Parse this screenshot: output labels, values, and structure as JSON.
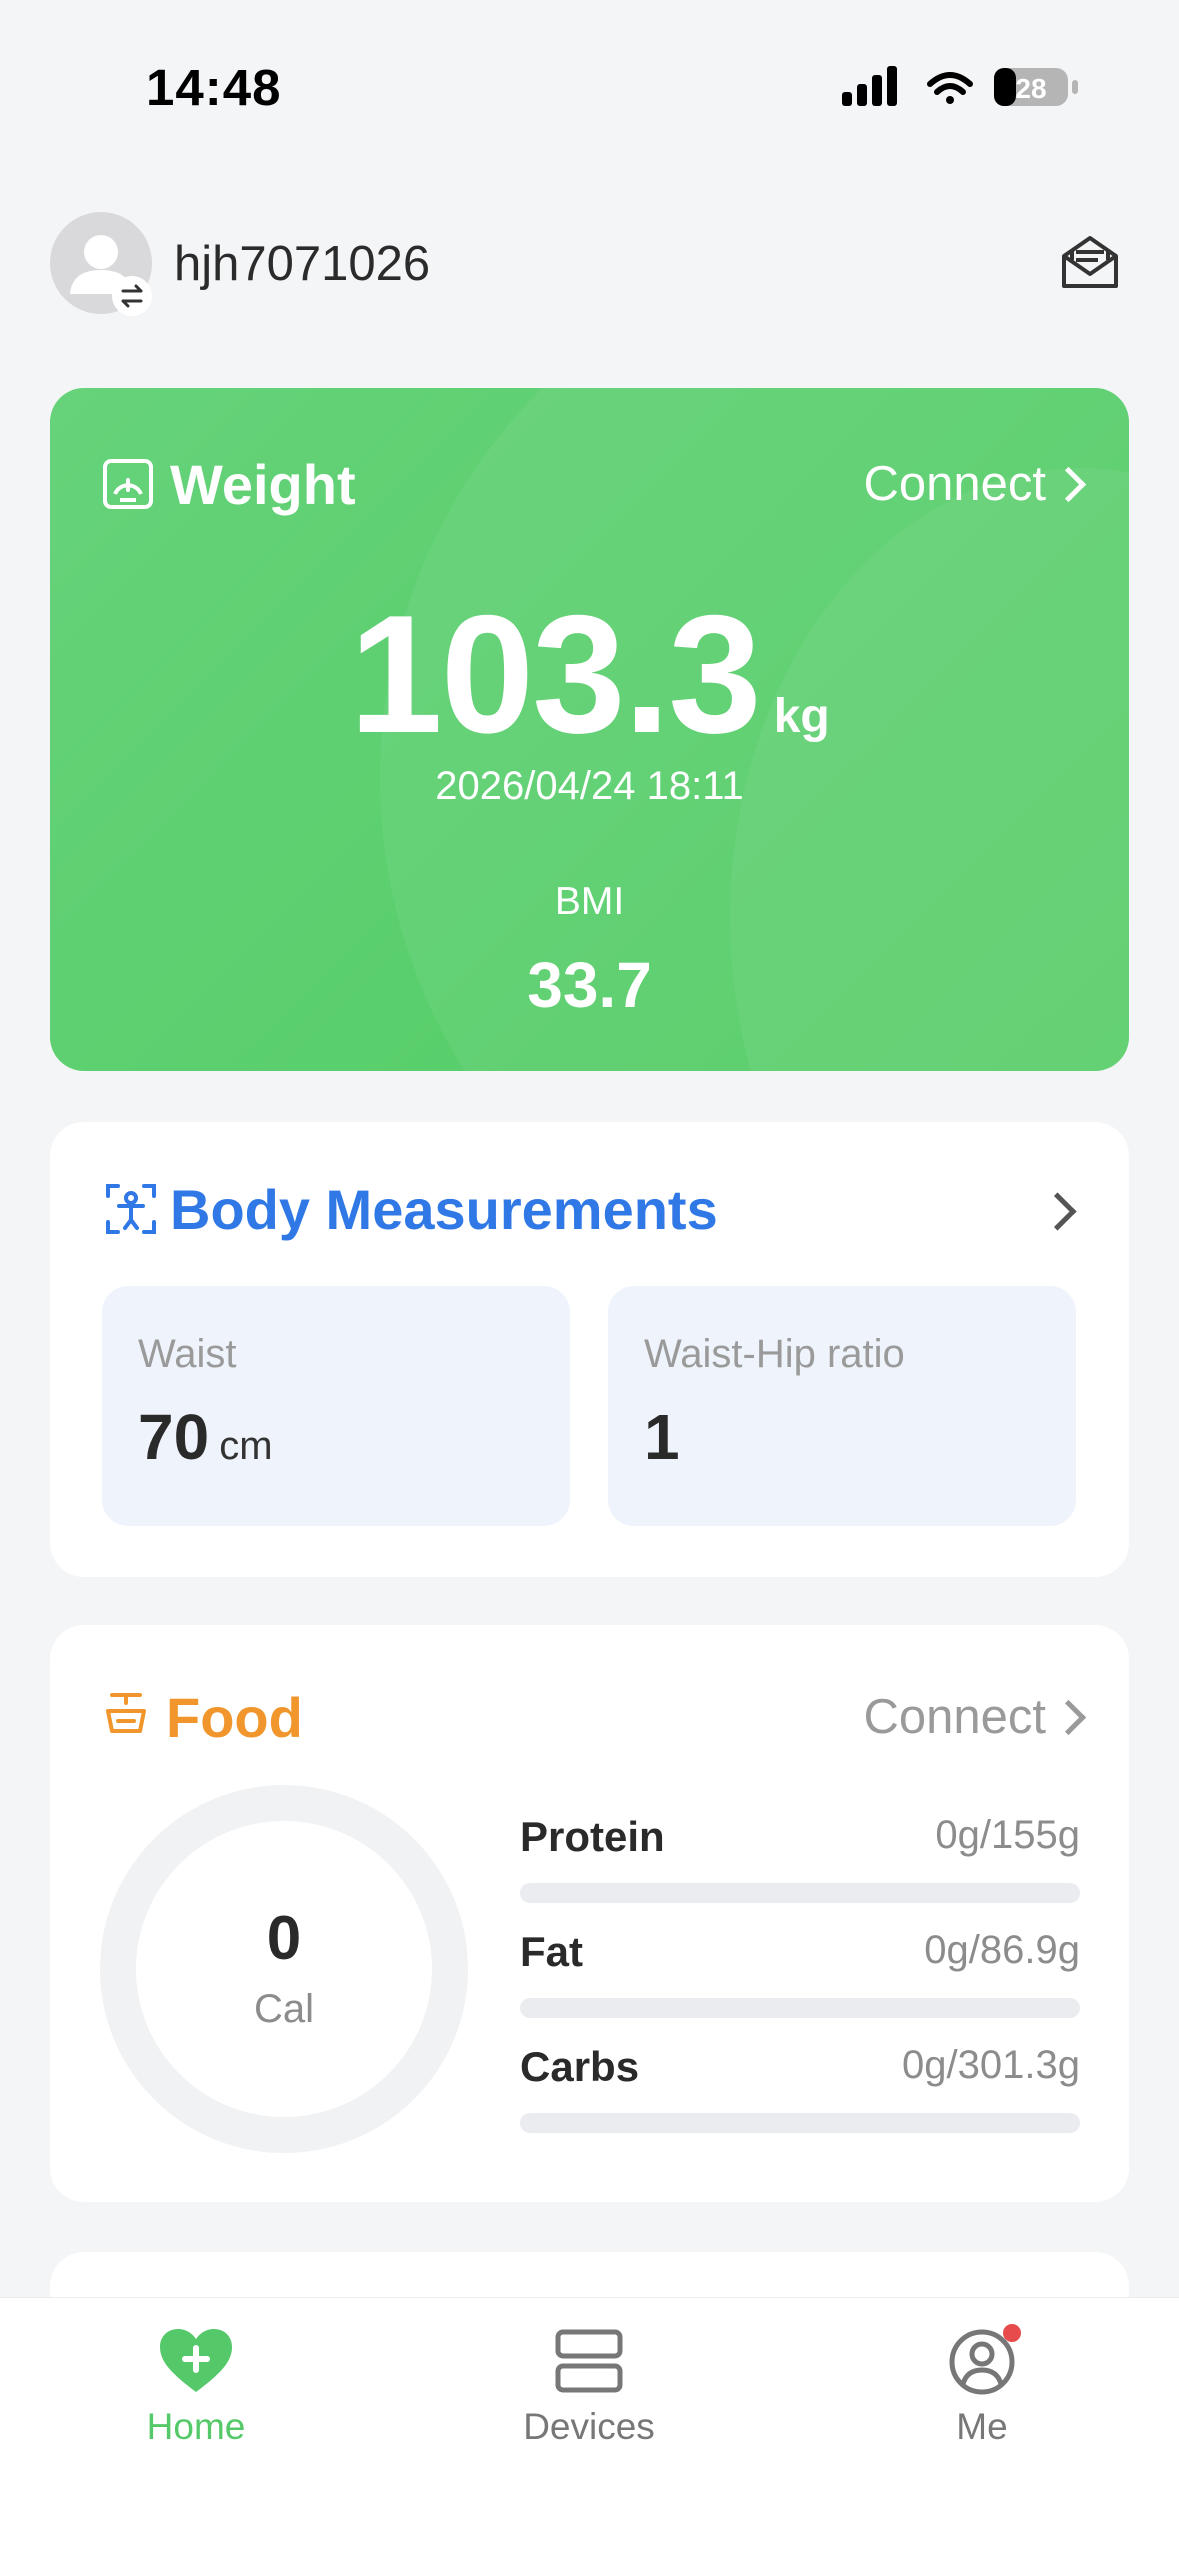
{
  "status_bar": {
    "time": "14:48",
    "battery": "28"
  },
  "header": {
    "username": "hjh7071026"
  },
  "weight_card": {
    "title": "Weight",
    "connect_label": "Connect",
    "value": "103.3",
    "unit": "kg",
    "timestamp": "2026/04/24 18:11",
    "bmi_label": "BMI",
    "bmi_value": "33.7"
  },
  "body_measurements": {
    "title": "Body Measurements",
    "tiles": [
      {
        "label": "Waist",
        "value": "70",
        "unit": "cm"
      },
      {
        "label": "Waist-Hip ratio",
        "value": "1",
        "unit": ""
      }
    ]
  },
  "food": {
    "title": "Food",
    "connect_label": "Connect",
    "calories": "0",
    "calories_unit": "Cal",
    "nutrients": [
      {
        "name": "Protein",
        "value": "0g/155g",
        "progress": 0
      },
      {
        "name": "Fat",
        "value": "0g/86.9g",
        "progress": 0
      },
      {
        "name": "Carbs",
        "value": "0g/301.3g",
        "progress": 0
      }
    ]
  },
  "tabbar": {
    "tabs": [
      {
        "label": "Home",
        "icon": "heart-plus-icon",
        "active": true
      },
      {
        "label": "Devices",
        "icon": "devices-icon",
        "active": false
      },
      {
        "label": "Me",
        "icon": "user-circle-icon",
        "active": false,
        "badge": true
      }
    ]
  },
  "colors": {
    "accent_green": "#55c96a",
    "body_blue": "#2f78e6",
    "food_orange": "#f0962c",
    "badge_red": "#e84b4b"
  }
}
